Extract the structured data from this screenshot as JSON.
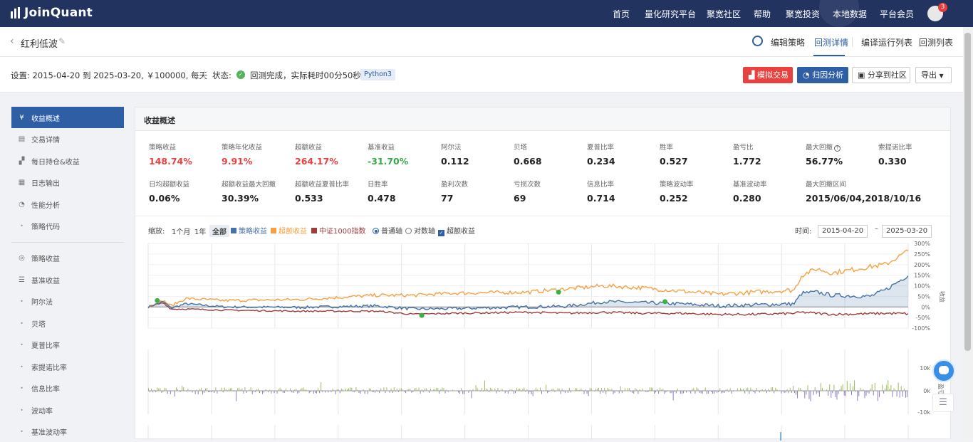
{
  "nav": {
    "brand": "JoinQuant",
    "items": [
      "首页",
      "量化研究平台",
      "聚宽社区",
      "帮助",
      "聚宽投资",
      "本地数据",
      "平台会员"
    ],
    "badge": "3"
  },
  "strategy": {
    "name": "红利低波",
    "tabs": [
      "编辑策略",
      "回测详情",
      "编译运行列表",
      "回测列表"
    ],
    "active_tab": "回测详情"
  },
  "settings": {
    "text": "设置:  2015-04-20 到 2025-03-20,  ￥100000,  每天",
    "status_label": "状态:",
    "status_text": "回测完成，实际耗时00分50秒",
    "python": "Python3",
    "buttons": {
      "simulate": "模拟交易",
      "attribution": "归因分析",
      "share": "分享到社区",
      "export": "导出"
    }
  },
  "sidebar": {
    "items": [
      {
        "label": "收益概述",
        "icon": "yen-icon",
        "glyph": "¥",
        "active": true
      },
      {
        "label": "交易详情",
        "icon": "document-icon",
        "glyph": "▤"
      },
      {
        "label": "每日持仓&收益",
        "icon": "bar-chart-icon",
        "glyph": "▞"
      },
      {
        "label": "日志输出",
        "icon": "calendar-icon",
        "glyph": "▦"
      },
      {
        "label": "性能分析",
        "icon": "pie-icon",
        "glyph": "◔"
      },
      {
        "label": "策略代码",
        "icon": "dot-icon",
        "glyph": "•"
      },
      {
        "label": "策略收益",
        "icon": "bulb-icon",
        "glyph": "◎"
      },
      {
        "label": "基准收益",
        "icon": "database-icon",
        "glyph": "☰"
      },
      {
        "label": "阿尔法",
        "icon": "dot-icon",
        "glyph": "•"
      },
      {
        "label": "贝塔",
        "icon": "dot-icon",
        "glyph": "•"
      },
      {
        "label": "夏普比率",
        "icon": "dot-icon",
        "glyph": "•"
      },
      {
        "label": "索提诺比率",
        "icon": "dot-icon",
        "glyph": "•"
      },
      {
        "label": "信息比率",
        "icon": "dot-icon",
        "glyph": "•"
      },
      {
        "label": "波动率",
        "icon": "dot-icon",
        "glyph": "•"
      },
      {
        "label": "基准波动率",
        "icon": "dot-icon",
        "glyph": "•"
      }
    ]
  },
  "overview": {
    "title": "收益概述",
    "metrics_row1": [
      {
        "label": "策略收益",
        "value": "148.74%",
        "color": "red"
      },
      {
        "label": "策略年化收益",
        "value": "9.91%",
        "color": "red"
      },
      {
        "label": "超额收益",
        "value": "264.17%",
        "color": "red"
      },
      {
        "label": "基准收益",
        "value": "-31.70%",
        "color": "green"
      },
      {
        "label": "阿尔法",
        "value": "0.112"
      },
      {
        "label": "贝塔",
        "value": "0.668"
      },
      {
        "label": "夏普比率",
        "value": "0.234"
      },
      {
        "label": "胜率",
        "value": "0.527"
      },
      {
        "label": "盈亏比",
        "value": "1.772"
      },
      {
        "label": "最大回撤",
        "value": "56.77%",
        "help": true
      },
      {
        "label": "索提诺比率",
        "value": "0.330"
      }
    ],
    "metrics_row2": [
      {
        "label": "日均超额收益",
        "value": "0.06%"
      },
      {
        "label": "超额收益最大回撤",
        "value": "30.39%"
      },
      {
        "label": "超额收益夏普比率",
        "value": "0.533"
      },
      {
        "label": "日胜率",
        "value": "0.478"
      },
      {
        "label": "盈利次数",
        "value": "77"
      },
      {
        "label": "亏损次数",
        "value": "69"
      },
      {
        "label": "信息比率",
        "value": "0.714"
      },
      {
        "label": "策略波动率",
        "value": "0.252"
      },
      {
        "label": "基准波动率",
        "value": "0.280"
      },
      {
        "label": "最大回撤区间",
        "value": "2015/06/04,2018/10/16"
      }
    ]
  },
  "chart_controls": {
    "zoom_label": "缩放:",
    "zoom_1m": "1个月",
    "zoom_1y": "1年",
    "zoom_all": "全部",
    "legend_strategy": "策略收益",
    "legend_excess": "超额收益",
    "legend_bench": "中证1000指数",
    "axis_normal": "普通轴",
    "axis_log": "对数轴",
    "chk_excess": "超额收益",
    "time_label": "时间:",
    "date_from": "2015-04-20",
    "date_to": "2025-03-20",
    "colors": {
      "strategy": "#4572a7",
      "excess": "#f7a041",
      "bench": "#a23a3a"
    }
  },
  "chart_data": [
    {
      "type": "line",
      "x_range": [
        "2015-04-20",
        "2025-03-20"
      ],
      "ylim": [
        -100,
        300
      ],
      "yticks": [
        "300%",
        "250%",
        "200%",
        "150%",
        "100%",
        "50%",
        "0%",
        "-50%",
        "-100%"
      ],
      "ylabel": "收益",
      "series": [
        {
          "name": "策略收益",
          "x": [
            0,
            0.02,
            0.03,
            0.05,
            0.1,
            0.2,
            0.3,
            0.35,
            0.4,
            0.5,
            0.55,
            0.6,
            0.65,
            0.7,
            0.75,
            0.8,
            0.85,
            0.86,
            0.88,
            0.9,
            0.95,
            0.97,
            1.0
          ],
          "values": [
            0,
            25,
            -5,
            15,
            0,
            -2,
            5,
            -10,
            -8,
            0,
            3,
            25,
            20,
            15,
            5,
            10,
            15,
            65,
            70,
            55,
            50,
            80,
            150
          ]
        },
        {
          "name": "超额收益",
          "x": [
            0,
            0.02,
            0.03,
            0.05,
            0.1,
            0.2,
            0.3,
            0.35,
            0.4,
            0.5,
            0.55,
            0.6,
            0.65,
            0.7,
            0.75,
            0.8,
            0.85,
            0.86,
            0.88,
            0.9,
            0.95,
            0.97,
            1.0
          ],
          "values": [
            0,
            30,
            5,
            40,
            30,
            35,
            55,
            55,
            65,
            70,
            85,
            100,
            90,
            75,
            60,
            70,
            80,
            150,
            180,
            160,
            190,
            200,
            265
          ]
        },
        {
          "name": "中证1000指数",
          "x": [
            0,
            0.02,
            0.03,
            0.05,
            0.1,
            0.2,
            0.3,
            0.35,
            0.4,
            0.5,
            0.55,
            0.6,
            0.65,
            0.7,
            0.75,
            0.8,
            0.85,
            0.86,
            0.88,
            0.9,
            0.95,
            0.97,
            1.0
          ],
          "values": [
            0,
            20,
            -10,
            -10,
            -15,
            -20,
            -20,
            -35,
            -30,
            -25,
            -30,
            -25,
            -30,
            -30,
            -35,
            -35,
            -30,
            -25,
            -30,
            -35,
            -32,
            -30,
            -32
          ]
        }
      ]
    },
    {
      "type": "bar",
      "yticks": [
        "10k",
        "0k",
        "-10k"
      ],
      "ylabel": "盈亏"
    }
  ]
}
